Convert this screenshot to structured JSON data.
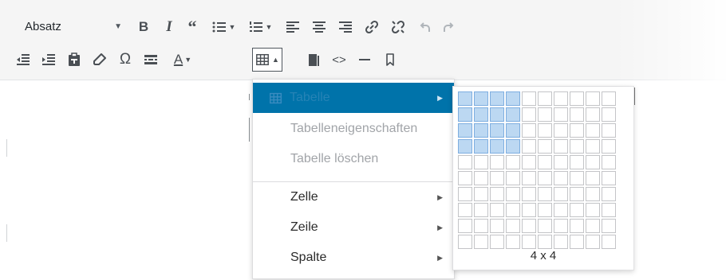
{
  "toolbar": {
    "format_select": {
      "value": "Absatz"
    },
    "row1_buttons": [
      {
        "name": "bold-button",
        "glyph": "B"
      },
      {
        "name": "italic-button",
        "glyph": "I"
      },
      {
        "name": "blockquote-button",
        "glyph": "66"
      }
    ]
  },
  "menu": {
    "table_label": "Tabelle",
    "table_properties": "Tabelleneigenschaften",
    "delete_table": "Tabelle löschen",
    "cell": "Zelle",
    "row": "Zeile",
    "column": "Spalte"
  },
  "grid": {
    "columns": 10,
    "rows": 10,
    "selected_cols": 4,
    "selected_rows": 4,
    "size_label": "4 x 4"
  },
  "colors": {
    "accent": "#0073aa",
    "selection": "#bcd8f2"
  }
}
